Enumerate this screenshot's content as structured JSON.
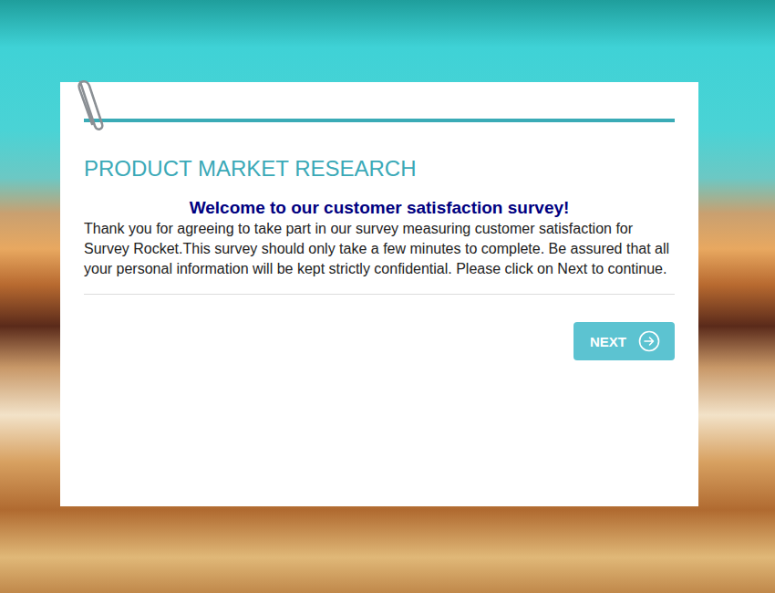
{
  "page": {
    "section_title": "PRODUCT MARKET RESEARCH",
    "heading": "Welcome to our customer satisfaction survey!",
    "body": "Thank you for agreeing to take part in our survey measuring customer satisfaction for Survey Rocket.This survey should only take a few minutes to complete. Be assured that all your personal information will be kept strictly confidential. Please click on Next to continue."
  },
  "buttons": [
    "NEXT"
  ]
}
